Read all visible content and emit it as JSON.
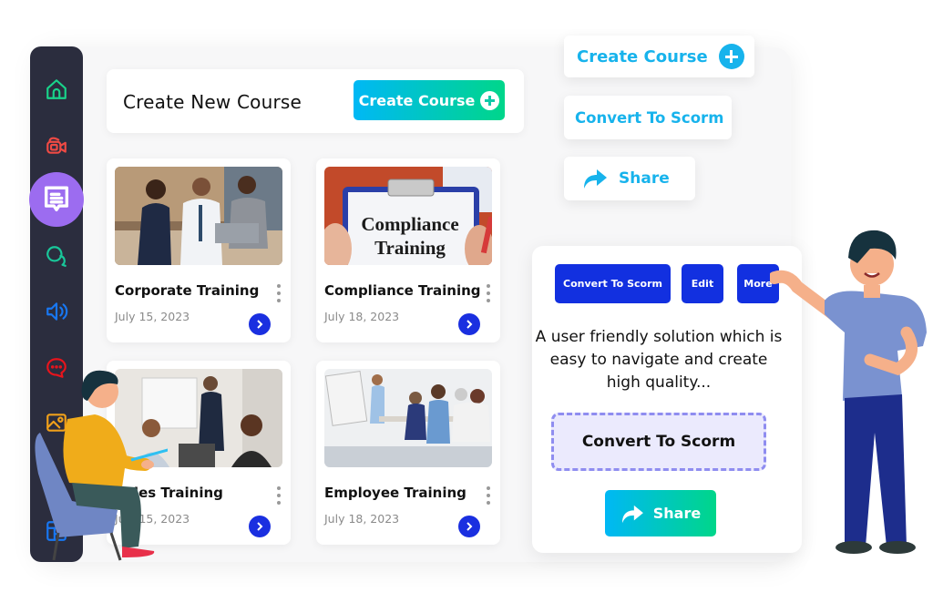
{
  "sidebar": {
    "items": [
      {
        "icon": "home-icon",
        "color": "#19d38a"
      },
      {
        "icon": "video-camera-icon",
        "color": "#ef4a44"
      },
      {
        "icon": "message-text-icon",
        "color": "#ffffff",
        "active": true,
        "active_bg": "#9c6cf0"
      },
      {
        "icon": "chat-bubbles-icon",
        "color": "#19c79a"
      },
      {
        "icon": "speaker-icon",
        "color": "#1877f2"
      },
      {
        "icon": "chat-dots-icon",
        "color": "#e8141c"
      },
      {
        "icon": "image-icon",
        "color": "#f0a01a"
      },
      {
        "icon": "table-layout-icon",
        "color": "#1877f2"
      }
    ]
  },
  "header": {
    "title": "Create New Course",
    "create_button_label": "Create Course"
  },
  "courses": [
    {
      "title": "Corporate Training",
      "date": "July 15, 2023",
      "image": "business-meeting-photo"
    },
    {
      "title": "Compliance Training",
      "date": "July 18, 2023",
      "image": "clipboard-compliance-photo",
      "image_text": [
        "Compliance",
        "Training"
      ]
    },
    {
      "title": "Sales Training",
      "date": "July 15, 2023",
      "image": "presentation-room-photo"
    },
    {
      "title": "Employee Training",
      "date": "July 18, 2023",
      "image": "whiteboard-training-photo"
    }
  ],
  "floating_actions": {
    "create_course": "Create Course",
    "convert_to_scorm": "Convert To Scorm",
    "share": "Share"
  },
  "detail_panel": {
    "buttons": [
      "Convert To Scorm",
      "Edit",
      "More"
    ],
    "description": "A user friendly solution which is easy to navigate and create high quality...",
    "convert_box_label": "Convert To Scorm",
    "share_label": "Share"
  },
  "colors": {
    "accent_blue": "#1230e0",
    "gradient_start": "#00b8f5",
    "gradient_end": "#00d68a",
    "light_blue_text": "#17b3ec",
    "sidebar_bg": "#2b2d3e"
  }
}
